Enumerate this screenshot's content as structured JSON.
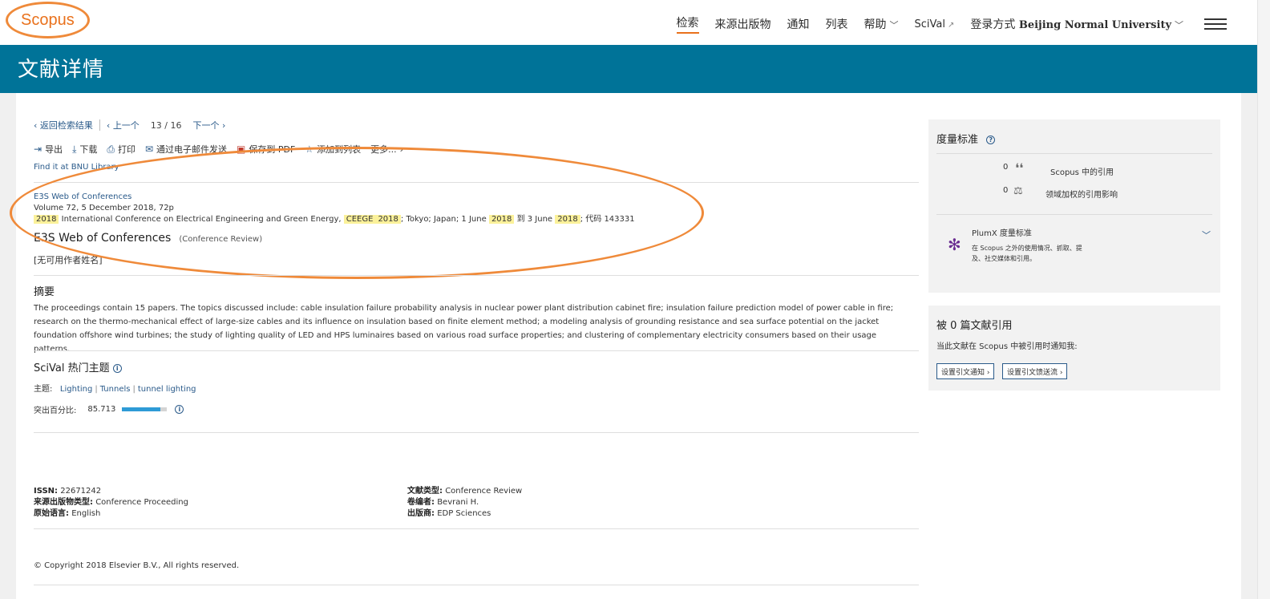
{
  "header": {
    "logo": "Scopus",
    "nav": {
      "search": "检索",
      "sources": "来源出版物",
      "alerts": "通知",
      "lists": "列表",
      "help": "帮助",
      "scival": "SciVal",
      "login_prefix": "登录方式",
      "login_institution": "Beijing Normal University"
    }
  },
  "banner": {
    "title": "文献详情"
  },
  "pager": {
    "back": "返回检索结果",
    "prev": "上一个",
    "current": "13",
    "total": "16",
    "next": "下一个"
  },
  "actions": {
    "export": "导出",
    "download": "下载",
    "print": "打印",
    "email": "通过电子邮件发送",
    "save_pdf": "保存到 PDF",
    "add_list": "添加到列表",
    "more": "更多..."
  },
  "find_it": "Find it at BNU Library",
  "source": {
    "title": "E3S Web of Conferences",
    "volume": "Volume 72, 5 December 2018, 72p",
    "conf_year": "2018",
    "conf_name": "International Conference on Electrical Engineering and Green Energy,",
    "conf_acr": "CEEGE",
    "conf_acr_year": "2018",
    "conf_loc": "; Tokyo; Japan; 1 June",
    "date_start_year": "2018",
    "to": "到 3 June",
    "date_end_year": "2018",
    "code": "; 代码 143331"
  },
  "document": {
    "title": "E3S Web of Conferences",
    "type": "(Conference Review)",
    "authors": "[无可用作者姓名]"
  },
  "abstract": {
    "heading": "摘要",
    "text": "The proceedings contain 15 papers. The topics discussed include: cable insulation failure probability analysis in nuclear power plant distribution cabinet fire; insulation failure prediction model of power cable in fire; research on the thermo-mechanical effect of large-size cables and its influence on insulation based on finite element method; a modeling analysis of grounding resistance and sea surface potential on the jacket foundation offshore wind turbines; the study of lighting quality of LED and HPS luminaires based on various road surface properties; and clustering of complementary electricity consumers based on their usage patterns."
  },
  "scival": {
    "heading": "SciVal 热门主题",
    "topic_label": "主题:",
    "topics": [
      "Lighting",
      "Tunnels",
      "tunnel lighting"
    ],
    "prominence_label": "突出百分比:",
    "prominence_value": "85.713",
    "prominence_percent": 85.713
  },
  "metadata": {
    "issn_label": "ISSN:",
    "issn": "22671242",
    "source_type_label": "来源出版物类型:",
    "source_type": "Conference Proceeding",
    "language_label": "原始语言:",
    "language": "English",
    "doc_type_label": "文献类型:",
    "doc_type": "Conference Review",
    "editor_label": "卷编者:",
    "editor": "Bevrani H.",
    "publisher_label": "出版商:",
    "publisher": "EDP Sciences"
  },
  "copyright": "© Copyright 2018 Elsevier B.V., All rights reserved.",
  "sidebar": {
    "metrics": {
      "heading": "度量标准",
      "citations_count": "0",
      "citations_label": "Scopus 中的引用",
      "fwci_count": "0",
      "fwci_label": "领域加权的引用影响",
      "plumx_title": "PlumX 度量标准",
      "plumx_desc": "在 Scopus 之外的使用情况、抓取、提及、社交媒体和引用。"
    },
    "cited_by": {
      "heading": "被 0 篇文献引用",
      "note": "当此文献在 Scopus 中被引用时通知我:",
      "alert_btn": "设置引文通知",
      "feed_btn": "设置引文馈送流"
    }
  },
  "colors": {
    "brand_orange": "#e9711c",
    "banner_blue": "#007398",
    "link_blue": "#2a5a8a",
    "highlight": "#fbf19a",
    "annotation_orange": "#ef8a3a"
  }
}
